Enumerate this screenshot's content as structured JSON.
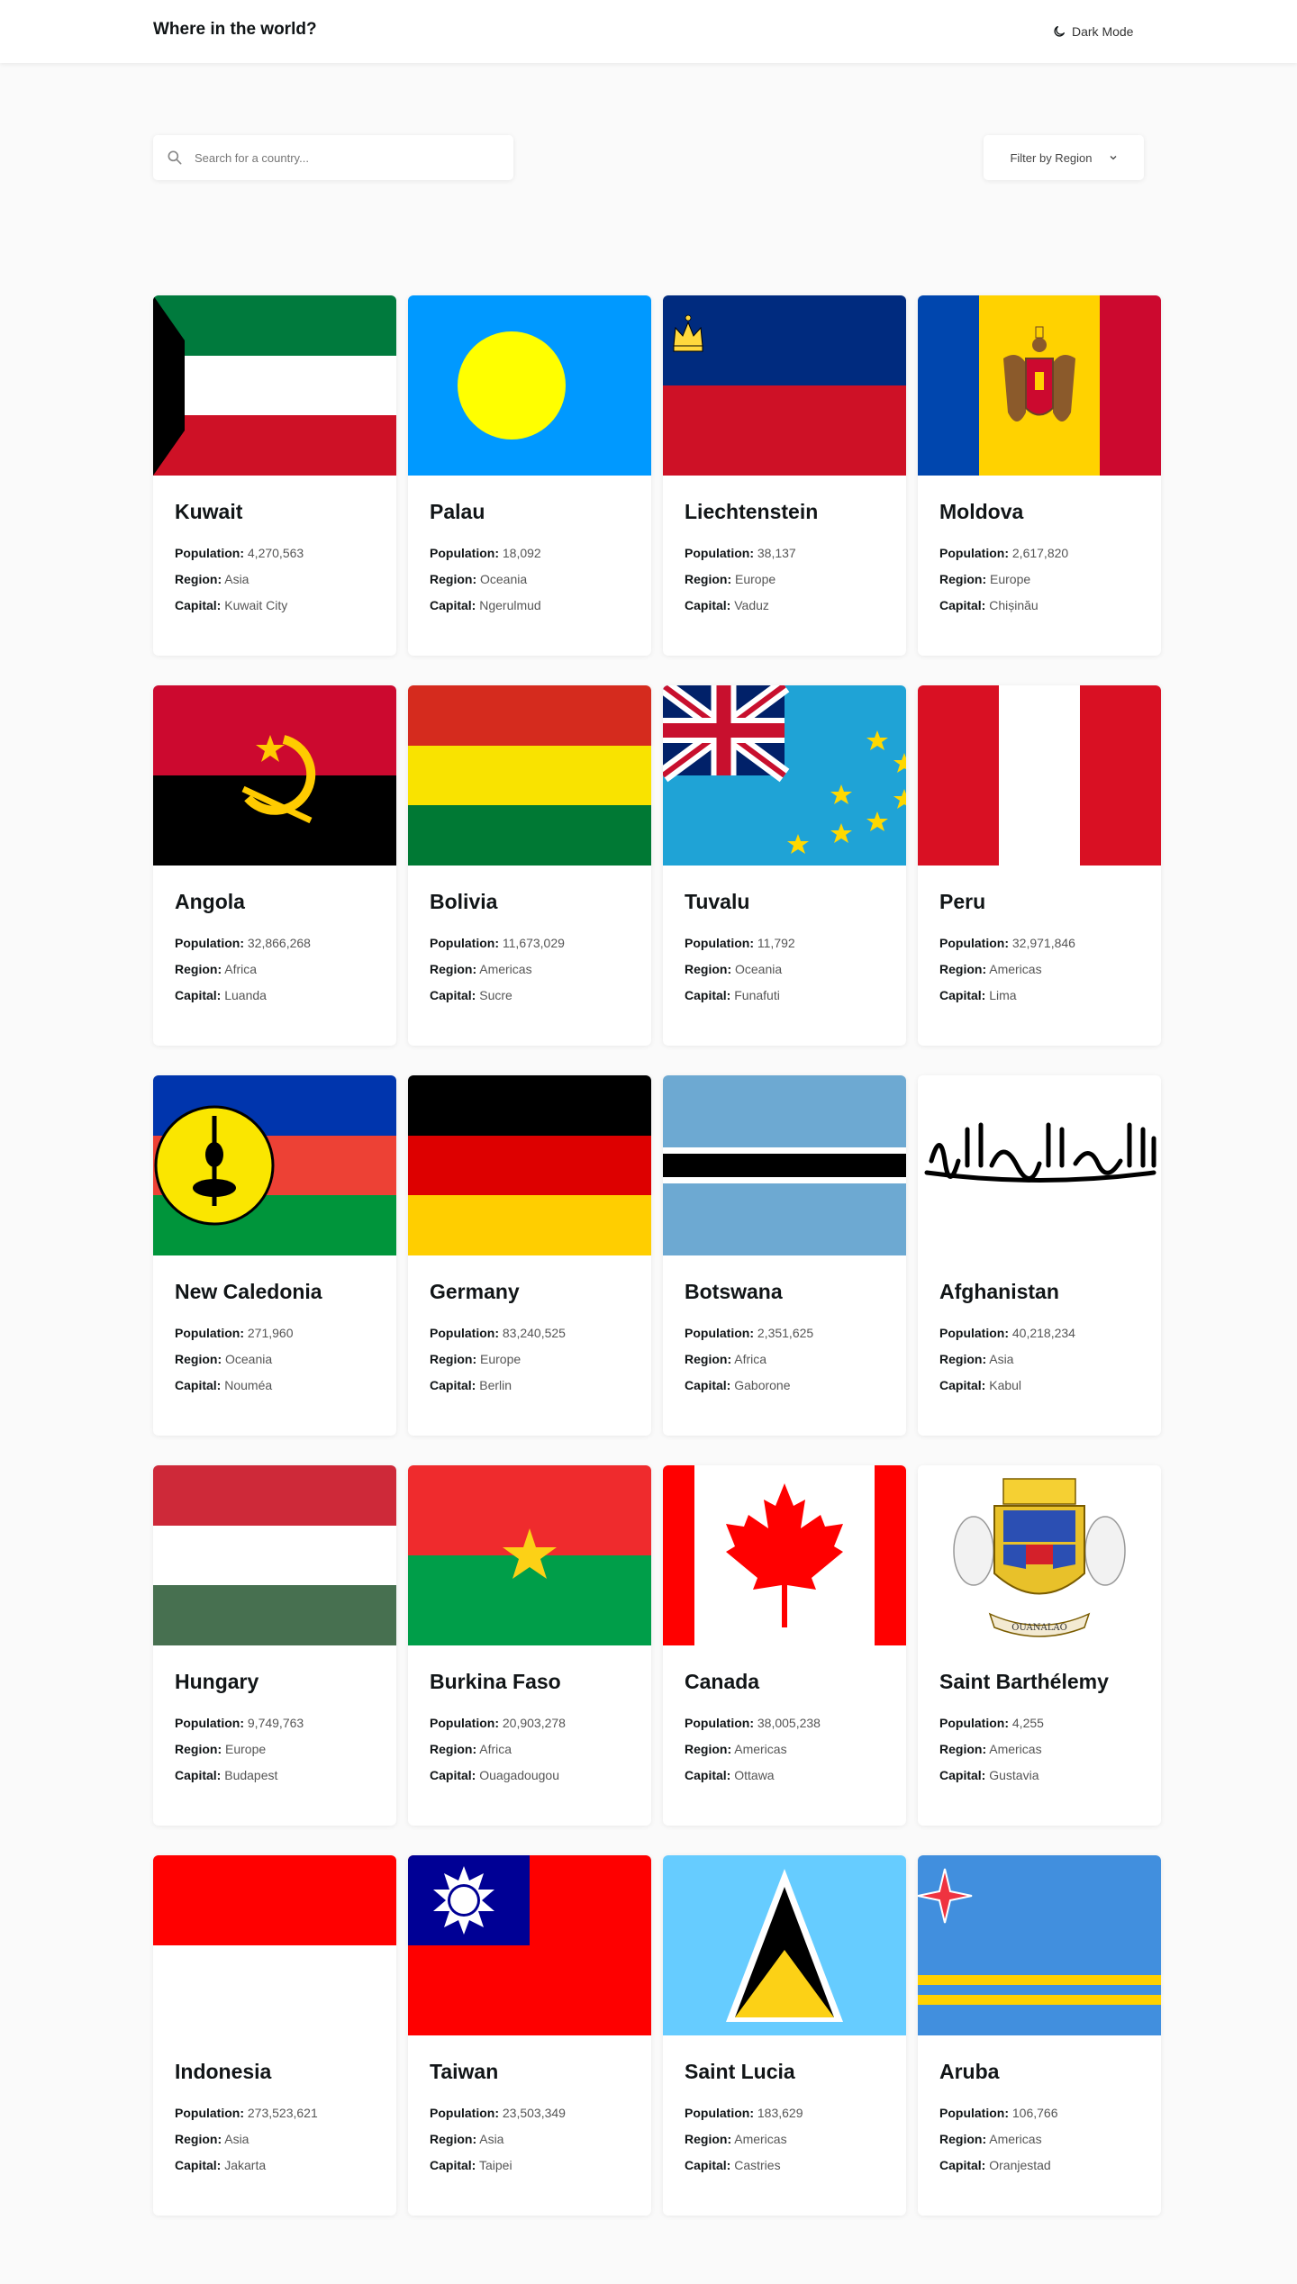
{
  "header": {
    "title": "Where in the world?",
    "dark_mode_label": "Dark Mode"
  },
  "search": {
    "placeholder": "Search for a country..."
  },
  "filter": {
    "label": "Filter by Region"
  },
  "labels": {
    "population": "Population:",
    "region": "Region:",
    "capital": "Capital:"
  },
  "countries": [
    {
      "name": "Kuwait",
      "population": "4,270,563",
      "region": "Asia",
      "capital": "Kuwait City"
    },
    {
      "name": "Palau",
      "population": "18,092",
      "region": "Oceania",
      "capital": "Ngerulmud"
    },
    {
      "name": "Liechtenstein",
      "population": "38,137",
      "region": "Europe",
      "capital": "Vaduz"
    },
    {
      "name": "Moldova",
      "population": "2,617,820",
      "region": "Europe",
      "capital": "Chișinău"
    },
    {
      "name": "Angola",
      "population": "32,866,268",
      "region": "Africa",
      "capital": "Luanda"
    },
    {
      "name": "Bolivia",
      "population": "11,673,029",
      "region": "Americas",
      "capital": "Sucre"
    },
    {
      "name": "Tuvalu",
      "population": "11,792",
      "region": "Oceania",
      "capital": "Funafuti"
    },
    {
      "name": "Peru",
      "population": "32,971,846",
      "region": "Americas",
      "capital": "Lima"
    },
    {
      "name": "New Caledonia",
      "population": "271,960",
      "region": "Oceania",
      "capital": "Nouméa"
    },
    {
      "name": "Germany",
      "population": "83,240,525",
      "region": "Europe",
      "capital": "Berlin"
    },
    {
      "name": "Botswana",
      "population": "2,351,625",
      "region": "Africa",
      "capital": "Gaborone"
    },
    {
      "name": "Afghanistan",
      "population": "40,218,234",
      "region": "Asia",
      "capital": "Kabul"
    },
    {
      "name": "Hungary",
      "population": "9,749,763",
      "region": "Europe",
      "capital": "Budapest"
    },
    {
      "name": "Burkina Faso",
      "population": "20,903,278",
      "region": "Africa",
      "capital": "Ouagadougou"
    },
    {
      "name": "Canada",
      "population": "38,005,238",
      "region": "Americas",
      "capital": "Ottawa"
    },
    {
      "name": "Saint Barthélemy",
      "population": "4,255",
      "region": "Americas",
      "capital": "Gustavia"
    },
    {
      "name": "Indonesia",
      "population": "273,523,621",
      "region": "Asia",
      "capital": "Jakarta"
    },
    {
      "name": "Taiwan",
      "population": "23,503,349",
      "region": "Asia",
      "capital": "Taipei"
    },
    {
      "name": "Saint Lucia",
      "population": "183,629",
      "region": "Americas",
      "capital": "Castries"
    },
    {
      "name": "Aruba",
      "population": "106,766",
      "region": "Americas",
      "capital": "Oranjestad"
    }
  ],
  "flag_seals": {
    "saint_barthelemy_motto": "OUANALAO"
  },
  "colors": {
    "background": "#fafafa",
    "card": "#ffffff",
    "text": "#111517"
  }
}
